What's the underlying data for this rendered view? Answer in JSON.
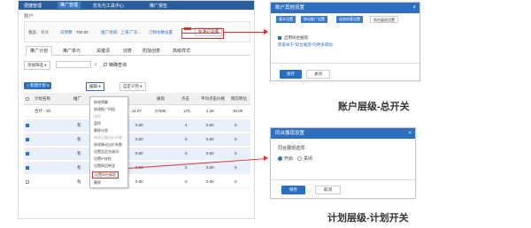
{
  "topnav": {
    "items": [
      "便捷管理",
      "推广管理",
      "优化与工具中心",
      "推广报告"
    ],
    "active_index": 1
  },
  "account": {
    "label": "账户",
    "status_label": "状态：",
    "status_value": "有效",
    "budget_label": "日预算",
    "budget_value": "700.00",
    "region_label": "推广地域：上海 广东…",
    "negative_label": "订物条数设置",
    "setting_button": "账户设置"
  },
  "main_tabs": [
    "推广计划",
    "推广单元",
    "关键词",
    "创意",
    "附加创意",
    "高级样式"
  ],
  "filter": {
    "add_filter": "添加筛选",
    "exact_query": "精确查询"
  },
  "toolbar": {
    "new_plan": "新建计划",
    "edit": "编辑",
    "custom_column": "自定义列"
  },
  "grid": {
    "headers": [
      "计划名称",
      "推广",
      "",
      "",
      "展现",
      "点击",
      "",
      "平均点击价格",
      "网页转化"
    ],
    "summary_row": {
      "name": "合计 - 20",
      "cost": "11.07",
      "impressions": "27935",
      "clicks": "170",
      "avg": "1.28",
      "conv": "30.00"
    },
    "rows": [
      {
        "name": "有",
        "budget": "0.00",
        "clicks": "4",
        "avg": "0.00",
        "conv": "0"
      },
      {
        "name": "有",
        "budget": "0.00",
        "clicks": "0",
        "avg": "0.00",
        "conv": "0"
      },
      {
        "name": "有",
        "budget": "0.00",
        "clicks": "0",
        "avg": "0.00",
        "conv": "0"
      },
      {
        "name": "有",
        "budget": "0.00",
        "clicks": "0",
        "avg": "0.00",
        "conv": "0"
      },
      {
        "name": "有",
        "budget": "0.00",
        "clicks": "0",
        "avg": "0.00",
        "conv": "0"
      }
    ]
  },
  "edit_menu": {
    "items": [
      {
        "label": "修改预算",
        "disabled": false
      },
      {
        "label": "修改推广时段",
        "disabled": false
      },
      {
        "label": "启用",
        "disabled": true
      },
      {
        "label": "暂停",
        "disabled": false
      },
      {
        "label": "删除计划",
        "disabled": false
      },
      {
        "label": "修改设备出价系数",
        "disabled": true
      },
      {
        "label": "修改移动出价系数",
        "disabled": false
      },
      {
        "label": "设置否定关键词",
        "disabled": false
      },
      {
        "label": "设置IP排除",
        "disabled": false
      },
      {
        "label": "设置网页转化",
        "disabled": false
      },
      {
        "label": "设置同台展现",
        "disabled": false,
        "highlighted": true
      },
      {
        "label": "删除",
        "disabled": false
      }
    ]
  },
  "dialog_account": {
    "title": "账户其他设置",
    "tabs": [
      "基本设置",
      "移动推广设置",
      "动态创意设置",
      "同台展现设置"
    ],
    "active_tab": 3,
    "checkbox_label": "启用同台展现",
    "checkbox_checked": true,
    "link_text": "获取关于\"同台展现\"的更多帮助",
    "save": "保存",
    "cancel": "关闭",
    "caption": "账户层级-总开关"
  },
  "dialog_plan": {
    "title": "同台展现设置",
    "field_label": "同台展现选项：",
    "option_on": "开启",
    "option_off": "关闭",
    "selected": "on",
    "save": "保存",
    "cancel": "取消",
    "caption": "计划层级-计划开关"
  },
  "colors": {
    "accent": "#2f6fbf",
    "highlight": "#e03030"
  }
}
